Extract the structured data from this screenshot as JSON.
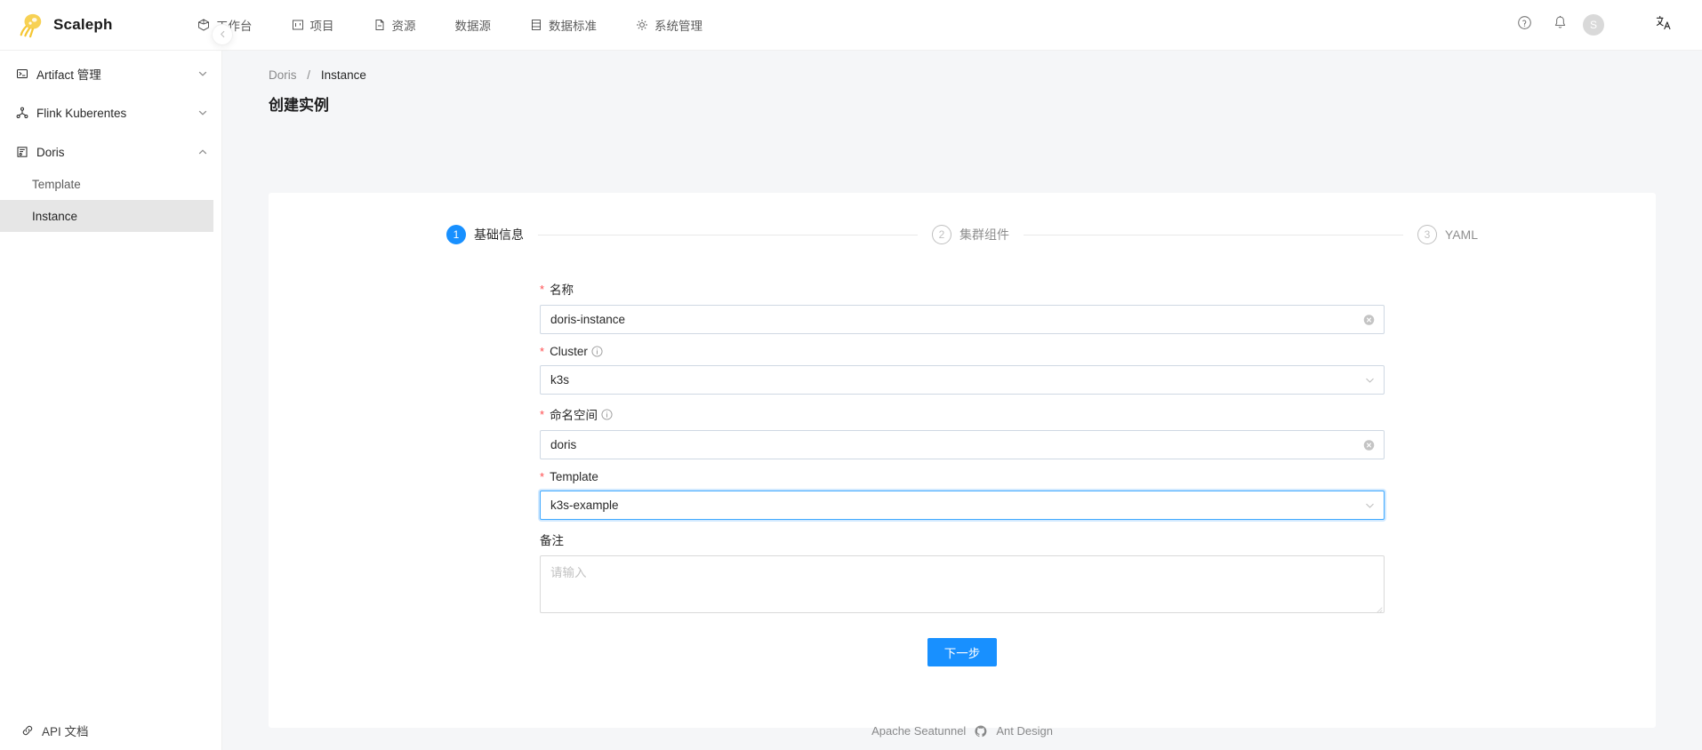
{
  "app": {
    "brand": "Scaleph",
    "logo_color": "#f5c633",
    "accent_color": "#1890ff",
    "required_color": "#ff4d4f"
  },
  "topnav": {
    "items": [
      {
        "label": "工作台",
        "icon": "dashboard-icon"
      },
      {
        "label": "项目",
        "icon": "project-icon"
      },
      {
        "label": "资源",
        "icon": "file-icon"
      },
      {
        "label": "数据源",
        "icon": ""
      },
      {
        "label": "数据标准",
        "icon": "database-icon"
      },
      {
        "label": "系统管理",
        "icon": "gear-icon"
      }
    ],
    "help_icon": "question-circle-icon",
    "bell_icon": "bell-icon",
    "avatar_initial": "S",
    "language_icon": "translate-icon"
  },
  "sidebar": {
    "groups": [
      {
        "label": "Artifact 管理",
        "icon": "console-icon",
        "expanded": false,
        "arrow": "chevron-down-icon"
      },
      {
        "label": "Flink Kuberentes",
        "icon": "cluster-icon",
        "expanded": false,
        "arrow": "chevron-down-icon"
      },
      {
        "label": "Doris",
        "icon": "doris-icon",
        "expanded": true,
        "arrow": "chevron-up-icon"
      }
    ],
    "doris_children": [
      {
        "label": "Template",
        "active": false
      },
      {
        "label": "Instance",
        "active": true
      }
    ],
    "bottom_link": {
      "label": "API 文档",
      "icon": "link-icon"
    },
    "collapse_icon": "chevron-left-icon"
  },
  "breadcrumb": {
    "parent": "Doris",
    "separator": "/",
    "current": "Instance"
  },
  "page": {
    "title": "创建实例"
  },
  "steps": [
    {
      "num": "1",
      "label": "基础信息",
      "state": "active"
    },
    {
      "num": "2",
      "label": "集群组件",
      "state": "wait"
    },
    {
      "num": "3",
      "label": "YAML",
      "state": "wait"
    }
  ],
  "form": {
    "fields": [
      {
        "key": "name",
        "label": "名称",
        "required": true,
        "has_info": false,
        "type": "input",
        "value": "doris-instance",
        "placeholder": "",
        "suffix_icon": "clear-circle-icon",
        "focused": false
      },
      {
        "key": "cluster",
        "label": "Cluster",
        "required": true,
        "has_info": true,
        "info_icon": "info-circle-icon",
        "type": "select",
        "value": "k3s",
        "placeholder": "",
        "suffix_icon": "chevron-down-icon",
        "focused": false
      },
      {
        "key": "namespace",
        "label": "命名空间",
        "required": true,
        "has_info": true,
        "info_icon": "info-circle-icon",
        "type": "input",
        "value": "doris",
        "placeholder": "",
        "suffix_icon": "clear-circle-icon",
        "focused": false
      },
      {
        "key": "template",
        "label": "Template",
        "required": true,
        "has_info": false,
        "type": "select",
        "value": "k3s-example",
        "placeholder": "",
        "suffix_icon": "chevron-down-icon",
        "focused": true
      }
    ],
    "remark": {
      "key": "remark",
      "label": "备注",
      "required": false,
      "type": "textarea",
      "value": "",
      "placeholder": "请输入"
    },
    "submit_label": "下一步"
  },
  "footer": {
    "left_link": "Apache Seatunnel",
    "github_icon": "github-icon",
    "right_link": "Ant Design"
  }
}
